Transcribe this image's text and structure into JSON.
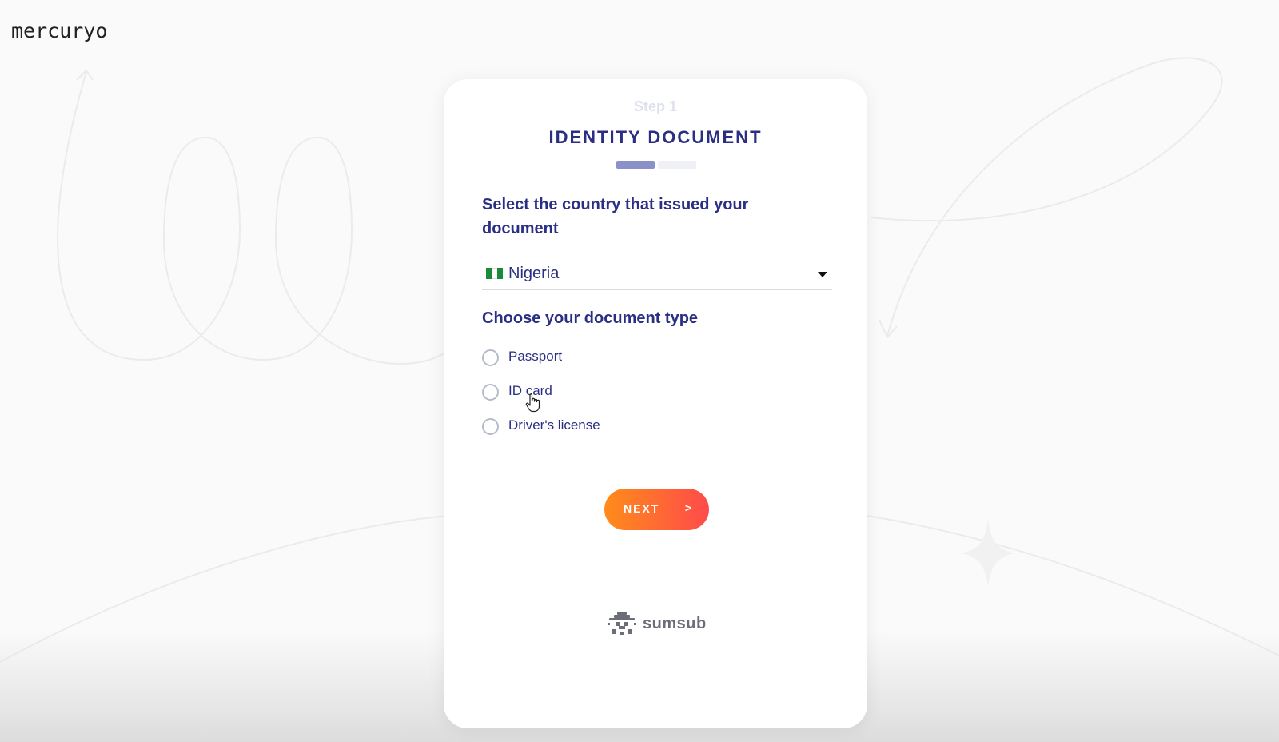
{
  "brand": {
    "logo_text": "mercuryo"
  },
  "step": {
    "label": "Step 1",
    "title": "IDENTITY DOCUMENT",
    "progress": {
      "current": 1,
      "total": 2
    }
  },
  "country_section": {
    "label": "Select the country that issued your document",
    "selected_country": "Nigeria",
    "flag_icon": "nigeria-flag-icon"
  },
  "document_section": {
    "label": "Choose your document type",
    "options": [
      {
        "label": "Passport",
        "selected": false
      },
      {
        "label": "ID card",
        "selected": false
      },
      {
        "label": "Driver's license",
        "selected": false
      }
    ]
  },
  "actions": {
    "next_label": "NEXT",
    "next_arrow": ">"
  },
  "footer": {
    "provider_name": "sumsub"
  },
  "colors": {
    "primary_text": "#2b2f84",
    "button_gradient_start": "#ff8c1a",
    "button_gradient_end": "#ff4b4b",
    "progress_active": "#8a91c9"
  }
}
